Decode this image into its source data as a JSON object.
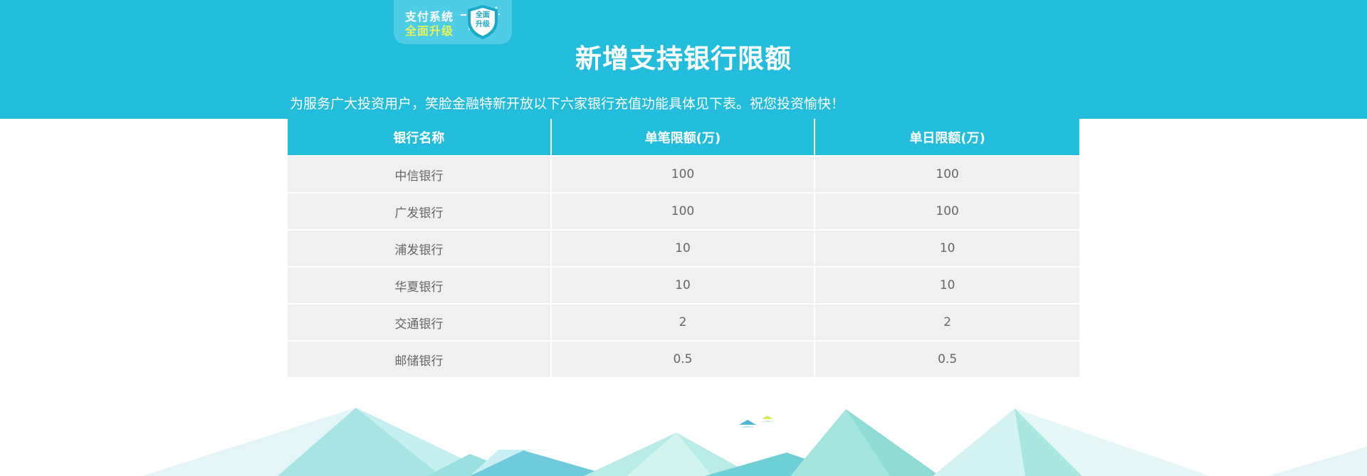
{
  "badge": {
    "line1": "支付系统",
    "line2": "全面升级",
    "shield_line1": "全面",
    "shield_line2": "升级"
  },
  "page_title": "新增支持银行限额",
  "intro": "为服务广大投资用户，笑脸金融特新开放以下六家银行充值功能具体见下表。祝您投资愉快！",
  "table": {
    "headers": [
      "银行名称",
      "单笔限额(万)",
      "单日限额(万)"
    ],
    "rows": [
      [
        "中信银行",
        "100",
        "100"
      ],
      [
        "广发银行",
        "100",
        "100"
      ],
      [
        "浦发银行",
        "10",
        "10"
      ],
      [
        "华夏银行",
        "10",
        "10"
      ],
      [
        "交通银行",
        "2",
        "2"
      ],
      [
        "邮储银行",
        "0.5",
        "0.5"
      ]
    ]
  },
  "colors": {
    "brand": "#22bddc",
    "row_bg": "#f0f0f0",
    "badge_accent": "#e6f35a"
  }
}
